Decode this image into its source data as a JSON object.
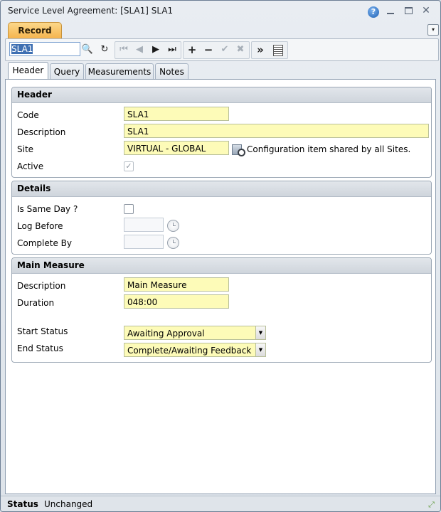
{
  "window": {
    "title": "Service Level Agreement: [SLA1] SLA1",
    "help_glyph": "?",
    "close_glyph": "✕"
  },
  "record_tab": {
    "label": "Record",
    "menu_glyph": "▾"
  },
  "toolbar": {
    "record_value": "SLA1",
    "search_glyph": "🔍",
    "refresh_glyph": "↻",
    "first_glyph": "⏮",
    "prev_glyph": "◀",
    "next_glyph": "▶",
    "last_glyph": "⏭",
    "add_glyph": "+",
    "remove_glyph": "−",
    "confirm_glyph": "✔",
    "cancel_glyph": "✖",
    "more_glyph": "»"
  },
  "tabs": [
    {
      "label": "Header"
    },
    {
      "label": "Query"
    },
    {
      "label": "Measurements"
    },
    {
      "label": "Notes"
    }
  ],
  "header_section": {
    "title": "Header",
    "code_label": "Code",
    "code_value": "SLA1",
    "description_label": "Description",
    "description_value": "SLA1",
    "site_label": "Site",
    "site_value": "VIRTUAL - GLOBAL",
    "site_note": "Configuration item shared by all Sites.",
    "active_label": "Active",
    "active_check": "✓"
  },
  "details_section": {
    "title": "Details",
    "same_day_label": "Is Same Day ?",
    "log_before_label": "Log Before",
    "log_before_value": "",
    "complete_by_label": "Complete By",
    "complete_by_value": ""
  },
  "main_measure_section": {
    "title": "Main Measure",
    "description_label": "Description",
    "description_value": "Main Measure",
    "duration_label": "Duration",
    "duration_value": "048:00",
    "start_status_label": "Start Status",
    "start_status_value": "Awaiting Approval",
    "end_status_label": "End Status",
    "end_status_value": "Complete/Awaiting Feedback",
    "dropdown_glyph": "▼"
  },
  "status_bar": {
    "label": "Status",
    "value": "Unchanged",
    "resize_glyph": "⤢"
  }
}
